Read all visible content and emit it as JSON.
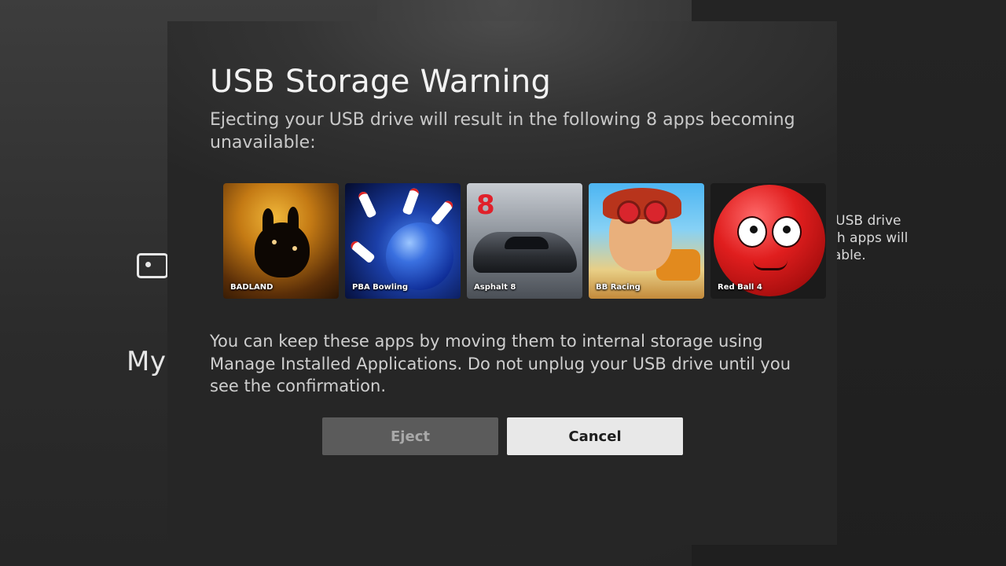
{
  "background": {
    "label_my": "My",
    "side_text": "ur USB drive\nhich apps will\nailable."
  },
  "dialog": {
    "title": "USB Storage Warning",
    "subtitle": "Ejecting your USB drive will result in the following 8 apps becoming unavailable:",
    "apps": [
      {
        "name": "BADLAND",
        "icon": "badland-app-icon"
      },
      {
        "name": "PBA Bowling",
        "icon": "pba-bowling-app-icon"
      },
      {
        "name": "Asphalt 8",
        "icon": "asphalt-8-app-icon",
        "badge": "8"
      },
      {
        "name": "BB Racing",
        "icon": "bb-racing-app-icon"
      },
      {
        "name": "Red Ball 4",
        "icon": "red-ball-4-app-icon"
      }
    ],
    "body": "You can keep these apps by moving them to internal storage using Manage Installed Applications. Do not unplug your USB drive until you see the confirmation.",
    "buttons": {
      "eject": "Eject",
      "cancel": "Cancel"
    }
  },
  "colors": {
    "dialog_bg": "#2e2e2e",
    "eject_bg": "#5b5b5b",
    "cancel_bg": "#e8e8e8"
  }
}
